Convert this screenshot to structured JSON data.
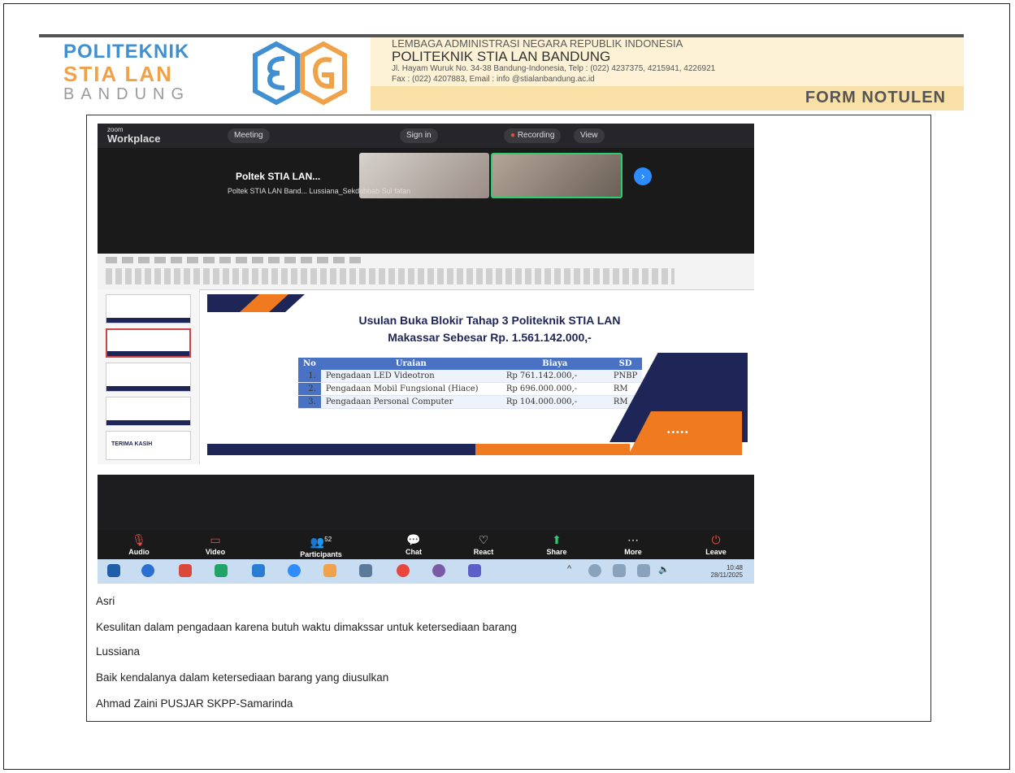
{
  "header": {
    "logo_line1": "POLITEKNIK",
    "logo_line2": "STIA LAN",
    "logo_line3": "BANDUNG",
    "ministry_line": "LEMBAGA ADMINISTRASI NEGARA REPUBLIK INDONESIA",
    "institution_name": "POLITEKNIK STIA LAN BANDUNG",
    "address_line": "Jl. Hayam Wuruk No. 34-38 Bandung-Indonesia, Telp : (022) 4237375, 4215941, 4226921",
    "contact_line": "Fax : (022) 4207883, Email : info @stialanbandung.ac.id",
    "form_title": "FORM NOTULEN",
    "colors": {
      "blue": "#3f8fd1",
      "orange": "#f0a24a",
      "band": "#f9e0a6"
    }
  },
  "zoom": {
    "app_small": "zoom",
    "app_name": "Workplace",
    "meeting_label": "Meeting",
    "sign_in": "Sign in",
    "recording": "Recording",
    "view": "View",
    "gallery_name": "Poltek STIA LAN...",
    "participant_labels": "Poltek STIA LAN Band...   Lussiana_Sekdubbab   Sul fafan",
    "toolbar": [
      {
        "label": "Audio",
        "icon": "microphone-muted-icon"
      },
      {
        "label": "Video",
        "icon": "camera-off-icon"
      },
      {
        "label": "Participants",
        "icon": "participants-icon",
        "count": "52"
      },
      {
        "label": "Chat",
        "icon": "chat-icon"
      },
      {
        "label": "React",
        "icon": "heart-icon"
      },
      {
        "label": "Share",
        "icon": "share-icon"
      },
      {
        "label": "More",
        "icon": "more-icon"
      },
      {
        "label": "Leave",
        "icon": "leave-icon"
      }
    ],
    "clock_time": "10:48",
    "clock_date": "28/11/2025"
  },
  "slide": {
    "title_line1": "Usulan Buka Blokir Tahap 3 Politeknik STIA LAN",
    "title_line2": "Makassar Sebesar Rp. 1.561.142.000,-",
    "table_headers": [
      "No",
      "Uraian",
      "Biaya",
      "SD"
    ],
    "table_rows": [
      {
        "no": "1.",
        "uraian": "Pengadaan LED Videotron",
        "biaya": "Rp 761.142.000,-",
        "sd": "PNBP"
      },
      {
        "no": "2.",
        "uraian": "Pengadaan Mobil Fungsional (Hiace)",
        "biaya": "Rp 696.000.000,-",
        "sd": "RM"
      },
      {
        "no": "3.",
        "uraian": "Pengadaan Personal Computer",
        "biaya": "Rp 104.000.000,-",
        "sd": "RM"
      }
    ],
    "thumb_last_label": "TERIMA KASIH",
    "dots": "•••••",
    "colors": {
      "navy": "#1e2557",
      "orange": "#f07a1f",
      "table_header": "#4a72c4"
    }
  },
  "notes": [
    "Asri",
    "Kesulitan dalam pengadaan karena butuh waktu dimakssar untuk ketersediaan barang",
    "Lussiana",
    "Baik kendalanya dalam ketersediaan barang yang diusulkan",
    "Ahmad Zaini  PUSJAR SKPP-Samarinda"
  ]
}
